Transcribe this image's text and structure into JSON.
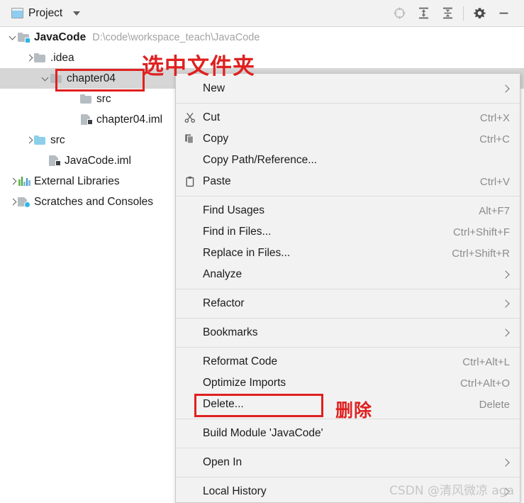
{
  "window": {
    "tab_label": "Project",
    "tab_icon": "project-window-icon",
    "caret_icon": "chevron-down-icon"
  },
  "toolbar": {
    "buttons": [
      {
        "name": "locate-icon",
        "title": "Select Opened File"
      },
      {
        "name": "expand-all-icon",
        "title": "Expand All"
      },
      {
        "name": "collapse-all-icon",
        "title": "Collapse All"
      },
      {
        "name": "settings-gear-icon",
        "title": "Settings"
      },
      {
        "name": "hide-minimize-icon",
        "title": "Hide"
      }
    ]
  },
  "tree": {
    "nodes": [
      {
        "label": "JavaCode",
        "path": "D:\\code\\workspace_teach\\JavaCode",
        "indent": 0,
        "twisty": "open",
        "icon": "module-folder-icon",
        "bold": true,
        "selected": false
      },
      {
        "label": ".idea",
        "path": "",
        "indent": 1,
        "twisty": "closed",
        "icon": "folder-icon",
        "bold": false,
        "selected": false
      },
      {
        "label": "chapter04",
        "path": "",
        "indent": 2,
        "twisty": "open",
        "icon": "folder-icon",
        "bold": false,
        "selected": true
      },
      {
        "label": "src",
        "path": "",
        "indent": 3,
        "twisty": "none",
        "icon": "folder-icon",
        "bold": false,
        "selected": false
      },
      {
        "label": "chapter04.iml",
        "path": "",
        "indent": 3,
        "twisty": "none",
        "icon": "iml-file-icon",
        "bold": false,
        "selected": false
      },
      {
        "label": "src",
        "path": "",
        "indent": 1,
        "twisty": "closed",
        "icon": "source-folder-icon",
        "bold": false,
        "selected": false
      },
      {
        "label": "JavaCode.iml",
        "path": "",
        "indent": 2,
        "twisty": "none",
        "icon": "iml-file-icon",
        "bold": false,
        "selected": false
      },
      {
        "label": "External Libraries",
        "path": "",
        "indent": 0,
        "twisty": "closed",
        "icon": "external-libraries-icon",
        "bold": false,
        "selected": false
      },
      {
        "label": "Scratches and Consoles",
        "path": "",
        "indent": 0,
        "twisty": "closed",
        "icon": "scratches-icon",
        "bold": false,
        "selected": false
      }
    ]
  },
  "context_menu": {
    "items": [
      {
        "type": "item",
        "name": "new",
        "label": "New",
        "mnemonic": "",
        "shortcut": "",
        "icon": "",
        "submenu": true
      },
      {
        "type": "sep"
      },
      {
        "type": "item",
        "name": "cut",
        "label": "Cut",
        "mnemonic": "t",
        "shortcut": "Ctrl+X",
        "icon": "scissors-icon",
        "submenu": false
      },
      {
        "type": "item",
        "name": "copy",
        "label": "Copy",
        "mnemonic": "C",
        "shortcut": "Ctrl+C",
        "icon": "copy-icon",
        "submenu": false
      },
      {
        "type": "item",
        "name": "copy-path-reference",
        "label": "Copy Path/Reference...",
        "mnemonic": "",
        "shortcut": "",
        "icon": "",
        "submenu": false
      },
      {
        "type": "item",
        "name": "paste",
        "label": "Paste",
        "mnemonic": "P",
        "shortcut": "Ctrl+V",
        "icon": "clipboard-icon",
        "submenu": false
      },
      {
        "type": "sep"
      },
      {
        "type": "item",
        "name": "find-usages",
        "label": "Find Usages",
        "mnemonic": "U",
        "shortcut": "Alt+F7",
        "icon": "",
        "submenu": false
      },
      {
        "type": "item",
        "name": "find-in-files",
        "label": "Find in Files...",
        "mnemonic": "",
        "shortcut": "Ctrl+Shift+F",
        "icon": "",
        "submenu": false
      },
      {
        "type": "item",
        "name": "replace-in-files",
        "label": "Replace in Files...",
        "mnemonic": "a",
        "shortcut": "Ctrl+Shift+R",
        "icon": "",
        "submenu": false
      },
      {
        "type": "item",
        "name": "analyze",
        "label": "Analyze",
        "mnemonic": "z",
        "shortcut": "",
        "icon": "",
        "submenu": true
      },
      {
        "type": "sep"
      },
      {
        "type": "item",
        "name": "refactor",
        "label": "Refactor",
        "mnemonic": "R",
        "shortcut": "",
        "icon": "",
        "submenu": true
      },
      {
        "type": "sep"
      },
      {
        "type": "item",
        "name": "bookmarks",
        "label": "Bookmarks",
        "mnemonic": "",
        "shortcut": "",
        "icon": "",
        "submenu": true
      },
      {
        "type": "sep"
      },
      {
        "type": "item",
        "name": "reformat-code",
        "label": "Reformat Code",
        "mnemonic": "R",
        "shortcut": "Ctrl+Alt+L",
        "icon": "",
        "submenu": false
      },
      {
        "type": "item",
        "name": "optimize-imports",
        "label": "Optimize Imports",
        "mnemonic": "z",
        "shortcut": "Ctrl+Alt+O",
        "icon": "",
        "submenu": false
      },
      {
        "type": "item",
        "name": "delete",
        "label": "Delete...",
        "mnemonic": "D",
        "shortcut": "Delete",
        "icon": "",
        "submenu": false
      },
      {
        "type": "sep"
      },
      {
        "type": "item",
        "name": "build-module",
        "label": "Build Module 'JavaCode'",
        "mnemonic": "M",
        "shortcut": "",
        "icon": "",
        "submenu": false
      },
      {
        "type": "sep"
      },
      {
        "type": "item",
        "name": "open-in",
        "label": "Open In",
        "mnemonic": "",
        "shortcut": "",
        "icon": "",
        "submenu": true
      },
      {
        "type": "sep"
      },
      {
        "type": "item",
        "name": "local-history",
        "label": "Local History",
        "mnemonic": "H",
        "shortcut": "",
        "icon": "",
        "submenu": true
      }
    ]
  },
  "annotations": {
    "select_folder_text": "选中文件夹",
    "delete_text": "删除",
    "highlight_color": "#e02020",
    "boxes": [
      {
        "name": "chapter04-highlight"
      },
      {
        "name": "delete-highlight"
      }
    ]
  },
  "watermark": {
    "text": "CSDN @清风微凉 aga"
  }
}
